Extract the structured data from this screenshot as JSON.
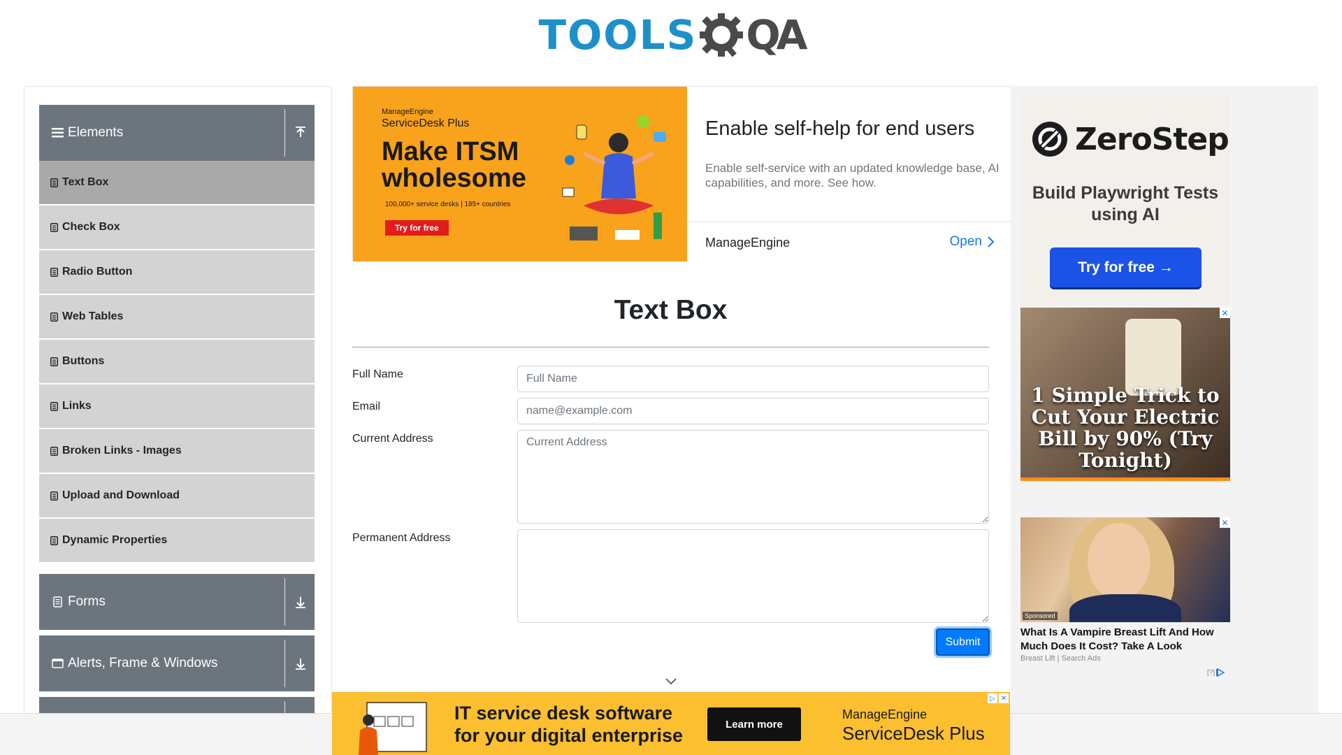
{
  "header": {
    "logo_tools": "TOOLS",
    "logo_qa": "QA"
  },
  "sidebar": {
    "elements_label": "Elements",
    "items": [
      {
        "label": "Text Box",
        "active": true
      },
      {
        "label": "Check Box"
      },
      {
        "label": "Radio Button"
      },
      {
        "label": "Web Tables"
      },
      {
        "label": "Buttons"
      },
      {
        "label": "Links"
      },
      {
        "label": "Broken Links - Images"
      },
      {
        "label": "Upload and Download"
      },
      {
        "label": "Dynamic Properties"
      }
    ],
    "forms_label": "Forms",
    "alerts_label": "Alerts, Frame & Windows"
  },
  "ad_top": {
    "brand_small": "ManageEngine",
    "brand_big": "ServiceDesk Plus",
    "headline": "Make ITSM wholesome",
    "sub": "100,000+ service desks | 185+ countries",
    "try_label": "Try for free",
    "title": "Enable self-help for end users",
    "description": "Enable self-service with an updated knowledge base, AI capabilities, and more. See how.",
    "advertiser": "ManageEngine",
    "open_label": "Open"
  },
  "main": {
    "title": "Text Box",
    "full_name_label": "Full Name",
    "full_name_placeholder": "Full Name",
    "email_label": "Email",
    "email_placeholder": "name@example.com",
    "current_address_label": "Current Address",
    "current_address_placeholder": "Current Address",
    "permanent_address_label": "Permanent Address",
    "submit_label": "Submit"
  },
  "right_ads": {
    "zerostep_name": "ZeroStep",
    "zerostep_sub": "Build Playwright Tests using AI",
    "zerostep_btn": "Try for free →",
    "trick_text": "1 Simple Trick to Cut Your Electric Bill by 90% (Try Tonight)",
    "sponsored": "Sponsored",
    "vampire_title": "What Is A Vampire Breast Lift And How Much Does It Cost? Take A Look",
    "vampire_source": "Breast Lift | Search Ads",
    "adchoices": "[?]"
  },
  "bottom_ad": {
    "line1": "IT service desk software",
    "line2": "for your digital enterprise",
    "learn_more": "Learn more",
    "brand_small": "ManageEngine",
    "brand_big": "ServiceDesk Plus"
  },
  "colors": {
    "accent": "#1e90c9",
    "sidebar_group": "#6c757d",
    "sidebar_item": "#d3d3d3",
    "sidebar_active": "#a9a9a9",
    "submit": "#007bff"
  }
}
